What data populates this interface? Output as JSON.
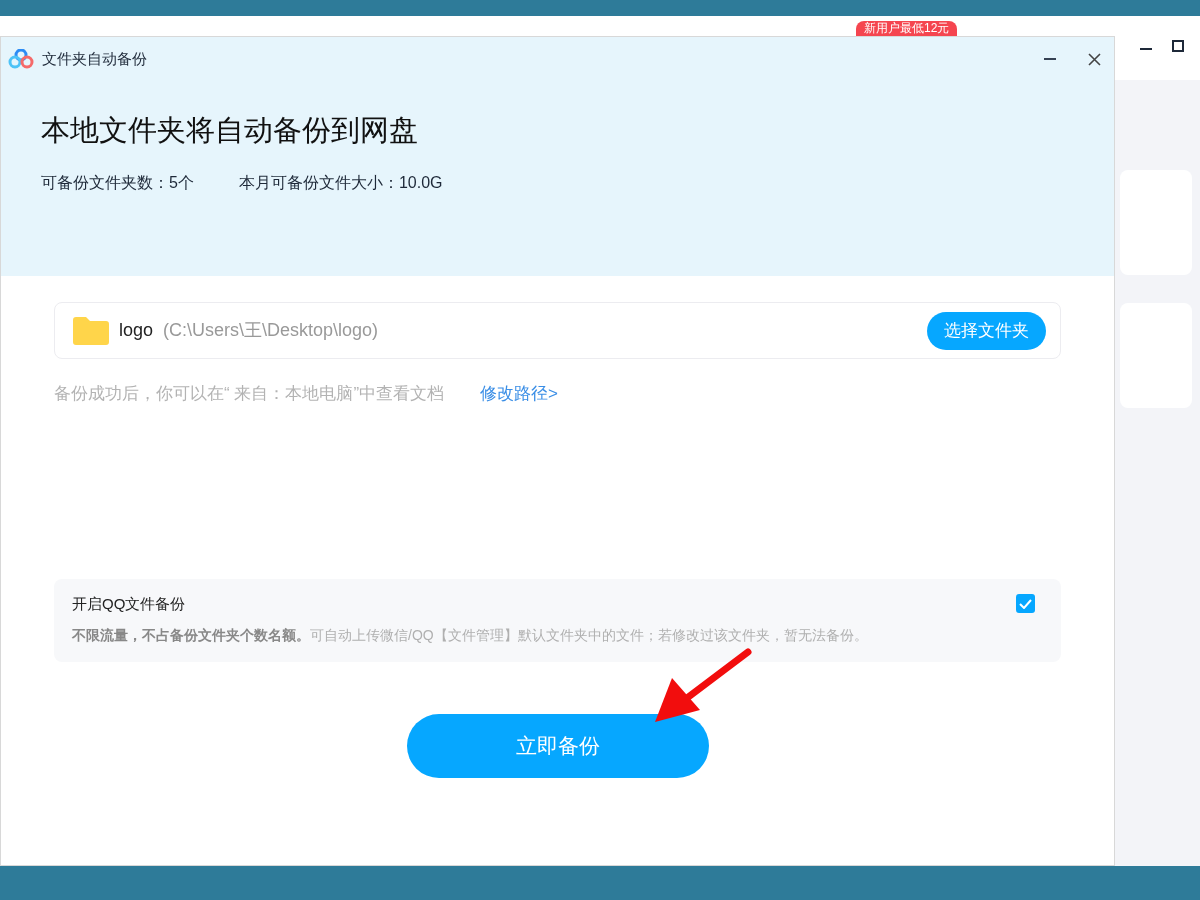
{
  "background_app": {
    "promo_badge": "新用户最低12元"
  },
  "dialog": {
    "title": "文件夹自动备份",
    "heading": "本地文件夹将自动备份到网盘",
    "stats": [
      "可备份文件夹数：5个",
      "本月可备份文件大小：10.0G"
    ],
    "folder": {
      "name": "logo",
      "path": "(C:\\Users\\王\\Desktop\\logo)",
      "button": "选择文件夹"
    },
    "hint": "备份成功后，你可以在“ 来自：本地电脑”中查看文档",
    "hint_link": "修改路径>",
    "qq_option": {
      "label": "开启QQ文件备份",
      "checked": true,
      "description": "**不限流量，不占备份文件夹个数名额。**可自动上传微信/QQ【文件管理】默认文件夹中的文件；若修改过该文件夹，暂无法备份。"
    },
    "primary_button": "立即备份"
  }
}
